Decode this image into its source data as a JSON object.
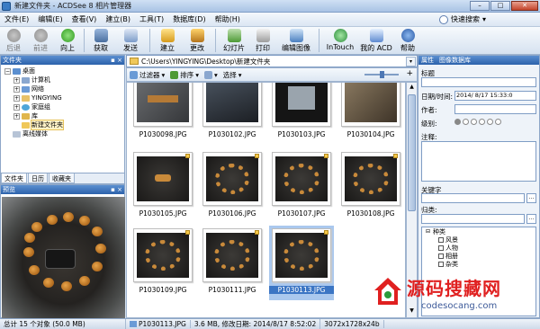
{
  "window": {
    "title": "新建文件夹 - ACDSee 8 相片管理器"
  },
  "menu": {
    "items": [
      "文件(E)",
      "编辑(E)",
      "查看(V)",
      "建立(B)",
      "工具(T)",
      "数据库(D)",
      "帮助(H)"
    ],
    "quick_search": "快速搜索"
  },
  "toolbar": {
    "back": "后退",
    "forward": "前进",
    "up": "向上",
    "acquire": "获取",
    "send": "发送",
    "create": "建立",
    "edit": "更改",
    "slideshow": "幻灯片",
    "print": "打印",
    "edit_image": "编辑图像",
    "intouch": "InTouch",
    "my_acd": "我的 ACD",
    "help": "帮助"
  },
  "folders": {
    "title": "文件夹",
    "tree": [
      {
        "label": "桌面",
        "level": 0
      },
      {
        "label": "计算机",
        "level": 1
      },
      {
        "label": "网络",
        "level": 1
      },
      {
        "label": "YINGYING",
        "level": 1
      },
      {
        "label": "家庭组",
        "level": 1
      },
      {
        "label": "库",
        "level": 1
      },
      {
        "label": "新建文件夹",
        "level": 1
      },
      {
        "label": "离线媒体",
        "level": 0
      }
    ],
    "tabs": [
      "文件夹",
      "日历",
      "收藏夹"
    ]
  },
  "preview": {
    "title": "预览"
  },
  "browser": {
    "path": "C:\\Users\\YINGYING\\Desktop\\新建文件夹",
    "filter": "过滤器",
    "sort": "排序",
    "select": "选择",
    "files": [
      "P1030098.JPG",
      "P1030102.JPG",
      "P1030103.JPG",
      "P1030104.JPG",
      "P1030105.JPG",
      "P1030106.JPG",
      "P1030107.JPG",
      "P1030108.JPG",
      "P1030109.JPG",
      "P1030111.JPG",
      "P1030113.JPG"
    ]
  },
  "properties": {
    "tabs": [
      "属性",
      "图像数据库"
    ],
    "title_label": "标题",
    "date_label": "日期/时间:",
    "date_value": "2014/ 8/17 15:33:0",
    "author_label": "作者:",
    "rating_label": "级别:",
    "notes_label": "注释:",
    "keywords_label": "关键字",
    "category_label": "归类:",
    "categories": [
      "种类",
      "风景",
      "人物",
      "相册",
      "杂类"
    ]
  },
  "status": {
    "total": "总计 15 个对象 (50.0 MB)",
    "file": "P1030113.JPG",
    "info": "3.6 MB, 修改日期: 2014/8/17 8:52:02",
    "dims": "3072x1728x24b"
  },
  "watermark": {
    "text": "源码搜藏网",
    "url": "codesocang.com"
  },
  "colors": {
    "accent": "#2c62ab",
    "selection": "#3b75c4",
    "watermark_red": "#e02020"
  }
}
